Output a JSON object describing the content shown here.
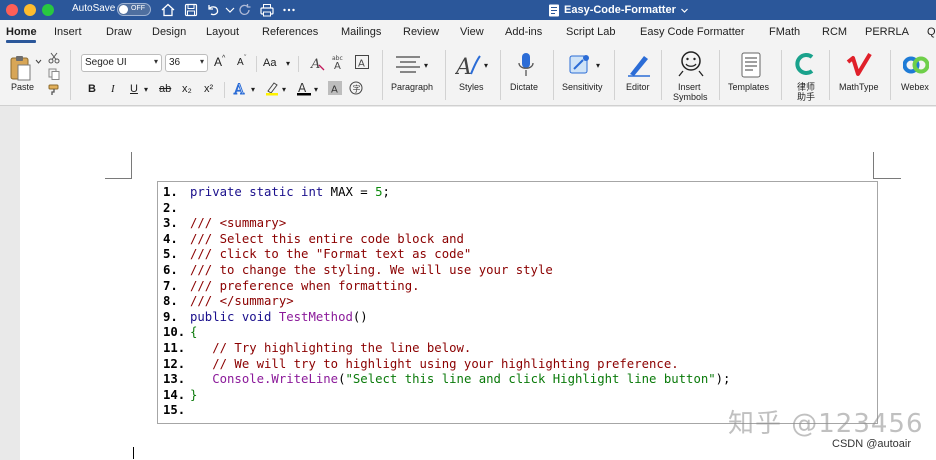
{
  "titlebar": {
    "autosave_label": "AutoSave",
    "autosave_state": "OFF",
    "doc_title": "Easy-Code-Formatter",
    "icons": [
      "home-icon",
      "save-icon",
      "undo-icon",
      "redo-icon",
      "print-icon",
      "more-icon"
    ]
  },
  "tabs": [
    {
      "label": "Home",
      "active": true
    },
    {
      "label": "Insert"
    },
    {
      "label": "Draw"
    },
    {
      "label": "Design"
    },
    {
      "label": "Layout"
    },
    {
      "label": "References"
    },
    {
      "label": "Mailings"
    },
    {
      "label": "Review"
    },
    {
      "label": "View"
    },
    {
      "label": "Add-ins"
    },
    {
      "label": "Script Lab"
    },
    {
      "label": "Easy Code Formatter"
    },
    {
      "label": "FMath"
    },
    {
      "label": "RCM"
    },
    {
      "label": "PERRLA"
    },
    {
      "label": "Q"
    }
  ],
  "ribbon": {
    "paste_label": "Paste",
    "font_name": "Segoe UI",
    "font_size": "36",
    "format_buttons": {
      "bold": "B",
      "italic": "I",
      "underline": "U",
      "strikethrough": "ab",
      "subscript": "x₂",
      "superscript": "x²",
      "case": "Aa",
      "grow": "A",
      "shrink": "A"
    },
    "paragraph_label": "Paragraph",
    "styles_label": "Styles",
    "dictate_label": "Dictate",
    "sensitivity_label": "Sensitivity",
    "editor_label": "Editor",
    "insert_symbols_label_1": "Insert",
    "insert_symbols_label_2": "Symbols",
    "templates_label": "Templates",
    "lvshi_label_1": "律师",
    "lvshi_label_2": "助手",
    "mathtype_label": "MathType",
    "webex_label": "Webex"
  },
  "code": {
    "lines": [
      {
        "num": "1.",
        "tokens": [
          {
            "t": "private static int ",
            "c": "kw"
          },
          {
            "t": "MAX = ",
            "c": "tx"
          },
          {
            "t": "5",
            "c": "nu"
          },
          {
            "t": ";",
            "c": "tx"
          }
        ]
      },
      {
        "num": "2.",
        "tokens": []
      },
      {
        "num": "3.",
        "tokens": [
          {
            "t": "/// <summary>",
            "c": "cm"
          }
        ]
      },
      {
        "num": "4.",
        "tokens": [
          {
            "t": "/// Select this entire code block and",
            "c": "cm"
          }
        ]
      },
      {
        "num": "5.",
        "tokens": [
          {
            "t": "/// click to the \"Format text as code\"",
            "c": "cm"
          }
        ]
      },
      {
        "num": "6.",
        "tokens": [
          {
            "t": "/// to change the styling. We will use your style",
            "c": "cm"
          }
        ]
      },
      {
        "num": "7.",
        "tokens": [
          {
            "t": "/// preference when formatting.",
            "c": "cm"
          }
        ]
      },
      {
        "num": "8.",
        "tokens": [
          {
            "t": "/// </summary>",
            "c": "cm"
          }
        ]
      },
      {
        "num": "9.",
        "tokens": [
          {
            "t": "public void ",
            "c": "kw"
          },
          {
            "t": "TestMethod",
            "c": "fn"
          },
          {
            "t": "()",
            "c": "tx"
          }
        ]
      },
      {
        "num": "10.",
        "tokens": [
          {
            "t": "{",
            "c": "st"
          }
        ]
      },
      {
        "num": "11.",
        "tokens": [
          {
            "t": "   // Try highlighting the line below.",
            "c": "cm"
          }
        ]
      },
      {
        "num": "12.",
        "tokens": [
          {
            "t": "   // We will try to highlight using your highlighting preference.",
            "c": "cm"
          }
        ]
      },
      {
        "num": "13.",
        "tokens": [
          {
            "t": "   Console.WriteLine",
            "c": "fn"
          },
          {
            "t": "(",
            "c": "tx"
          },
          {
            "t": "\"Select this line and click Highlight line button\"",
            "c": "st"
          },
          {
            "t": ");",
            "c": "tx"
          }
        ]
      },
      {
        "num": "14.",
        "tokens": [
          {
            "t": "}",
            "c": "st"
          }
        ]
      },
      {
        "num": "15.",
        "tokens": []
      }
    ]
  },
  "watermark": "知乎 @123456",
  "credit": "CSDN @autoair",
  "colors": {
    "titlebar": "#2b579a",
    "ribbon": "#f3f3f3",
    "keyword": "#1a0f8c",
    "comment": "#8b0000",
    "string": "#0a7a0a"
  }
}
